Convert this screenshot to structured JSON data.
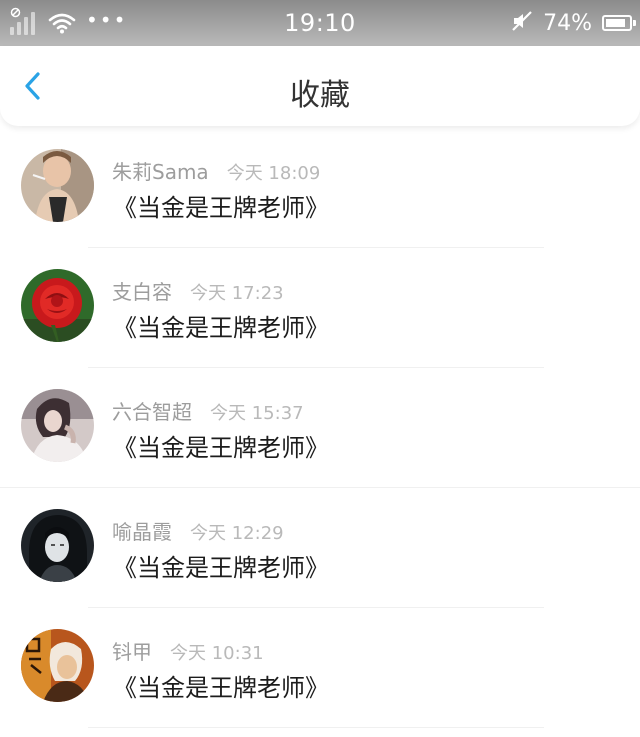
{
  "status_bar": {
    "time": "19:10",
    "battery_percent": "74%",
    "battery_level": 0.74,
    "icons": [
      "signal-icon",
      "wifi-icon",
      "more-icon",
      "mute-icon",
      "battery-icon"
    ]
  },
  "nav": {
    "title": "收藏",
    "back_icon": "chevron-left-icon",
    "accent_color": "#2aa3e6"
  },
  "favorites": [
    {
      "name": "朱莉Sama",
      "time": "今天 18:09",
      "title": "《当金是王牌老师》"
    },
    {
      "name": "支白容",
      "time": "今天 17:23",
      "title": "《当金是王牌老师》"
    },
    {
      "name": "六合智超",
      "time": "今天 15:37",
      "title": "《当金是王牌老师》"
    },
    {
      "name": "喻晶霞",
      "time": "今天 12:29",
      "title": "《当金是王牌老师》"
    },
    {
      "name": "钭甲",
      "time": "今天 10:31",
      "title": "《当金是王牌老师》"
    }
  ]
}
